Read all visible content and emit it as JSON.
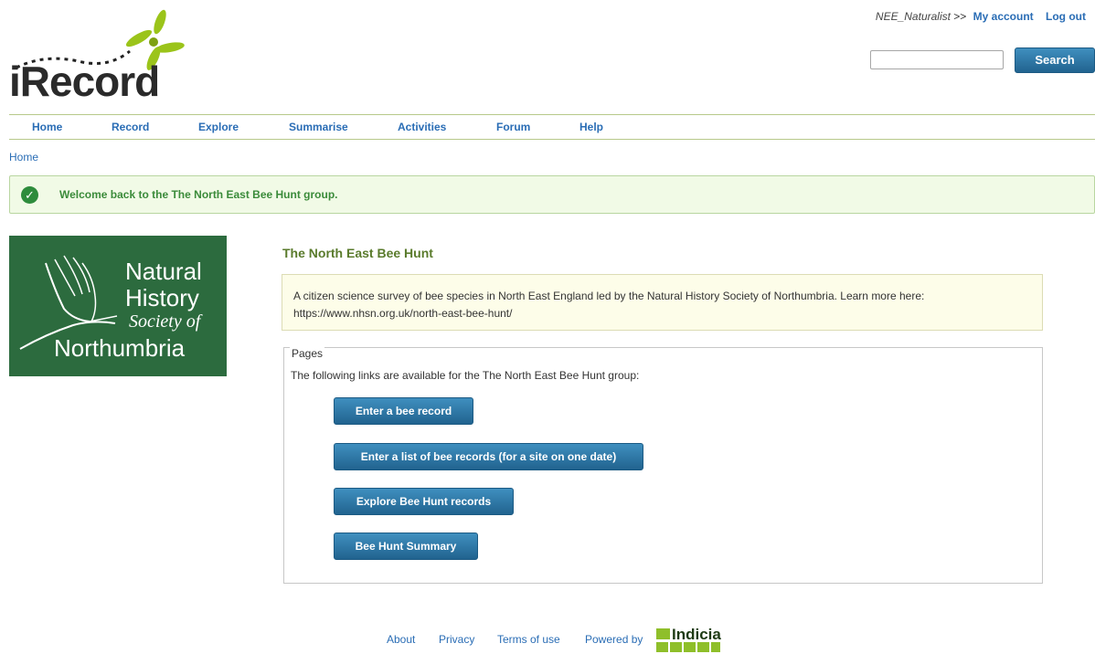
{
  "header": {
    "logo_text": "iRecord",
    "username": "NEE_Naturalist",
    "separator": ">>",
    "my_account": "My account",
    "log_out": "Log out",
    "search_placeholder": "",
    "search_label": "Search"
  },
  "nav": {
    "items": [
      "Home",
      "Record",
      "Explore",
      "Summarise",
      "Activities",
      "Forum",
      "Help"
    ]
  },
  "breadcrumb": "Home",
  "alert": {
    "message": "Welcome back to the The North East Bee Hunt group."
  },
  "group_logo": {
    "line1": "Natural",
    "line2": "History",
    "line3": "Society of",
    "line4": "Northumbria"
  },
  "group": {
    "title": "The North East Bee Hunt",
    "description_line1": "A citizen science survey of bee species in North East England led by the Natural History Society of Northumbria. Learn more here:",
    "description_line2": "https://www.nhsn.org.uk/north-east-bee-hunt/"
  },
  "pages": {
    "legend": "Pages",
    "intro": "The following links are available for the The North East Bee Hunt group:",
    "buttons": [
      "Enter a bee record",
      "Enter a list of bee records (for a site on one date)",
      "Explore Bee Hunt records",
      "Bee Hunt Summary"
    ]
  },
  "footer": {
    "about": "About",
    "privacy": "Privacy",
    "terms": "Terms of use",
    "powered_by": "Powered by",
    "indicia": "Indicia"
  },
  "colors": {
    "link": "#2a6db5",
    "button": "#2e78a8",
    "nav_border": "#b7c98a",
    "alert_bg": "#f1fae6",
    "group_logo_bg": "#2c6b3e"
  }
}
